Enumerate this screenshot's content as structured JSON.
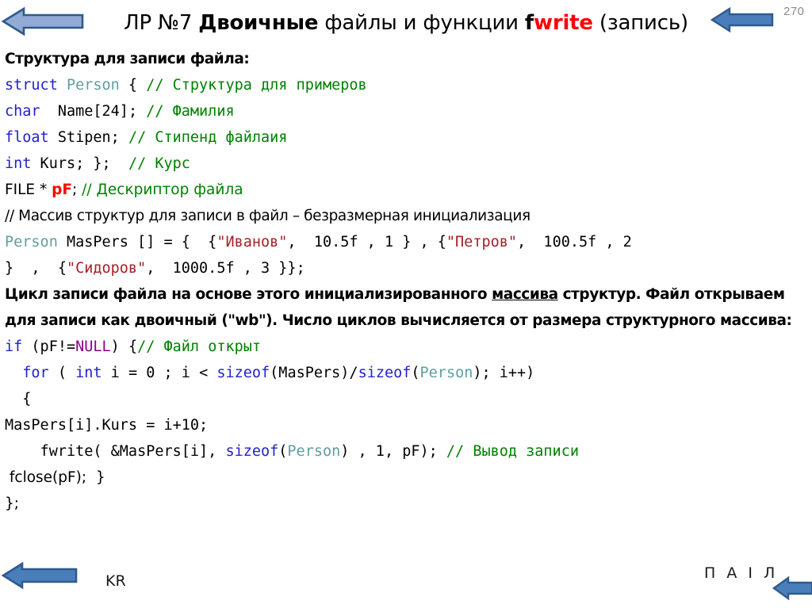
{
  "slide": {
    "page_number": "270",
    "title": {
      "part1": "ЛР №7 ",
      "part2_bold": "Двоичные",
      "part3": " файлы и функции ",
      "part4_bold_black": "f",
      "part5_bold_red": "write",
      "part6": " (запись)",
      "full_text": "ЛР №7 Двоичные файлы и функции fwrite (запись)"
    },
    "heading": "Структура для записи файла:",
    "code_block_1": {
      "line1": {
        "kw": "struct",
        "sp1": " ",
        "type": "Person",
        "brace": " { ",
        "comment": "// Структура для примеров"
      },
      "line2": {
        "kw": "char",
        "text": "  Name[24]; ",
        "comment": "// Фамилия"
      },
      "line3": {
        "kw": "float",
        "text": " Stipen; ",
        "comment": "// Стипенд файлаия"
      },
      "line4": {
        "kw": "int",
        "text": " Kurs; }; ",
        "comment": " // Курс"
      },
      "line5": {
        "pre": "FILE * ",
        "pf": "pF",
        "mid": "; ",
        "comment": "// Дескриптор файла"
      }
    },
    "note_1": "// Массив структур для записи в файл – безразмерная инициализация",
    "array_init": {
      "line1_a": "Person",
      "line1_b": " MasPers [] = {  {",
      "line1_s1": "\"Иванов\"",
      "line1_c": ",  10.5f , 1 } , {",
      "line1_s2": "\"Петров\"",
      "line1_d": ",  100.5f , 2",
      "line2_a": "}  ,  {",
      "line2_s3": "\"Сидоров\"",
      "line2_b": ",  1000.5f , 3 }};"
    },
    "paragraph_1": {
      "seg1": "Цикл записи файла на основе этого инициализированного ",
      "seg2_underline": "массива",
      "seg3": " структур. Файл открываем для записи как двоичный (\"wb\"). Число циклов вычисляется от размера структурного массива:"
    },
    "code_block_2": {
      "line1": {
        "kw_if": "if",
        "t1": " (pF!=",
        "null": "NULL",
        "t2": ") {",
        "comment": "// Файл открыт"
      },
      "line2": {
        "indent": "  ",
        "kw_for": "for",
        "t1": " ( ",
        "kw_int": "int",
        "t2": " i = 0 ; i < ",
        "sizeof1": "sizeof",
        "t3": "(MasPers)/",
        "sizeof2": "sizeof",
        "t4": "(",
        "type": "Person",
        "t5": "); i++)"
      },
      "line3": "  {",
      "line4": "MasPers[i].Kurs = i+10;",
      "line5": {
        "indent": "    fwrite( &MasPers[i], ",
        "sizeof": "sizeof",
        "t1": "(",
        "type": "Person",
        "t2": ") , 1, pF); ",
        "comment": "// Вывод записи"
      },
      "line6": " fclose(pF);  }",
      "line7": "};"
    },
    "footer": {
      "left": "KR",
      "right": "П А І Л"
    },
    "colors": {
      "keyword": "#2222cc",
      "type": "#5f9ea0",
      "comment": "#008000",
      "string": "#a52028",
      "null": "#8b008b",
      "accent_red": "#ff0000",
      "arrow_fill": "#4a7ebb",
      "arrow_fill_light": "#91abd4",
      "arrow_stroke": "#2e5a8e",
      "page_number_color": "#8d8d8d"
    },
    "icons": {
      "arrow_top_left": "arrow-left-icon",
      "arrow_top_right": "arrow-left-icon",
      "arrow_bottom_left": "arrow-left-icon",
      "arrow_bottom_right": "arrow-left-icon"
    }
  }
}
